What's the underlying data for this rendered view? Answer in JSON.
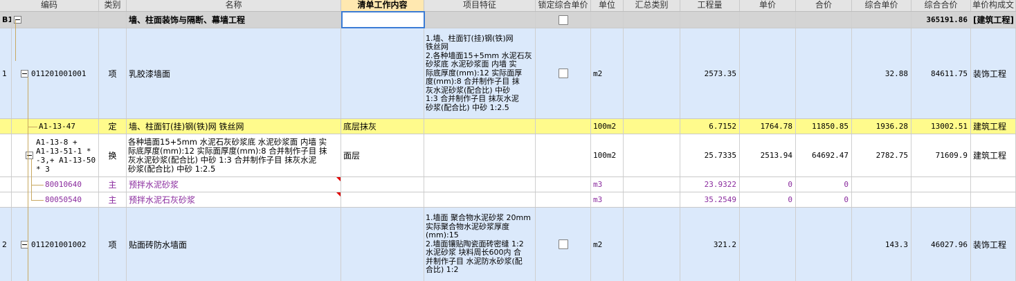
{
  "headers": [
    "编码",
    "类别",
    "名称",
    "清单工作内容",
    "项目特征",
    "锁定综合单价",
    "单位",
    "汇总类别",
    "工程量",
    "单价",
    "合价",
    "综合单价",
    "综合合价",
    "单价构成文"
  ],
  "rows": {
    "section": {
      "seq": "B1",
      "name": "墙、柱面装饰与隔断、幕墙工程",
      "total": "365191.86",
      "fee": "[建筑工程]"
    },
    "item1": {
      "seq": "1",
      "code": "011201001001",
      "cat": "项",
      "name": "乳胶漆墙面",
      "feature": "1.墙、柱面钉(挂)钢(铁)网\n铁丝网\n2.各种墙面15+5mm 水泥石灰\n砂浆底 水泥砂浆面 内墙  实\n际底厚度(mm):12  实际面厚\n度(mm):8  合并制作子目 抹\n灰水泥砂浆(配合比) 中砂\n1:3  合并制作子目 抹灰水泥\n砂浆(配合比) 中砂 1:2.5",
      "unit": "m2",
      "qty": "2573.35",
      "unit_total": "32.88",
      "total": "84611.75",
      "fee": "装饰工程"
    },
    "sub1": {
      "code": "A1-13-47",
      "cat": "定",
      "name": "墙、柱面钉(挂)钢(铁)网 铁丝网",
      "work": "底层抹灰",
      "unit": "100m2",
      "qty": "6.7152",
      "price": "1764.78",
      "amount": "11850.85",
      "unit_total": "1936.28",
      "total": "13002.51",
      "fee": "建筑工程"
    },
    "sub2": {
      "code": "A1-13-8 +\nA1-13-51-1 *\n-3,+ A1-13-50\n* 3",
      "cat": "换",
      "name": "各种墙面15+5mm 水泥石灰砂浆底 水泥砂浆面 内墙  实\n际底厚度(mm):12  实际面厚度(mm):8  合并制作子目 抹\n灰水泥砂浆(配合比) 中砂 1:3  合并制作子目 抹灰水泥\n砂浆(配合比) 中砂 1:2.5",
      "work": "面层",
      "unit": "100m2",
      "qty": "25.7335",
      "price": "2513.94",
      "amount": "64692.47",
      "unit_total": "2782.75",
      "total": "71609.9",
      "fee": "建筑工程"
    },
    "mat1": {
      "code": "80010640",
      "cat": "主",
      "name": "预拌水泥砂浆",
      "unit": "m3",
      "qty": "23.9322",
      "price": "0",
      "amount": "0"
    },
    "mat2": {
      "code": "80050540",
      "cat": "主",
      "name": "预拌水泥石灰砂浆",
      "unit": "m3",
      "qty": "35.2549",
      "price": "0",
      "amount": "0"
    },
    "item2": {
      "seq": "2",
      "code": "011201001002",
      "cat": "项",
      "name": "贴面砖防水墙面",
      "feature": "1.墙面 聚合物水泥砂浆 20mm\n 实际聚合物水泥砂浆厚度\n(mm):15\n2.墙面镶贴陶瓷面砖密缝 1:2\n水泥砂浆 块料周长600内  合\n并制作子目 水泥防水砂浆(配\n合比) 1:2",
      "unit": "m2",
      "qty": "321.2",
      "unit_total": "143.3",
      "total": "46027.96",
      "fee": "装饰工程"
    }
  },
  "colors": {
    "header_bg": "#e4e4e4",
    "section_bg": "#d4d4d4",
    "item_bg": "#dbe9fb",
    "highlight_bg": "#fffb8c",
    "material_text": "#8a2b9e",
    "selection_border": "#3a7bd5"
  }
}
